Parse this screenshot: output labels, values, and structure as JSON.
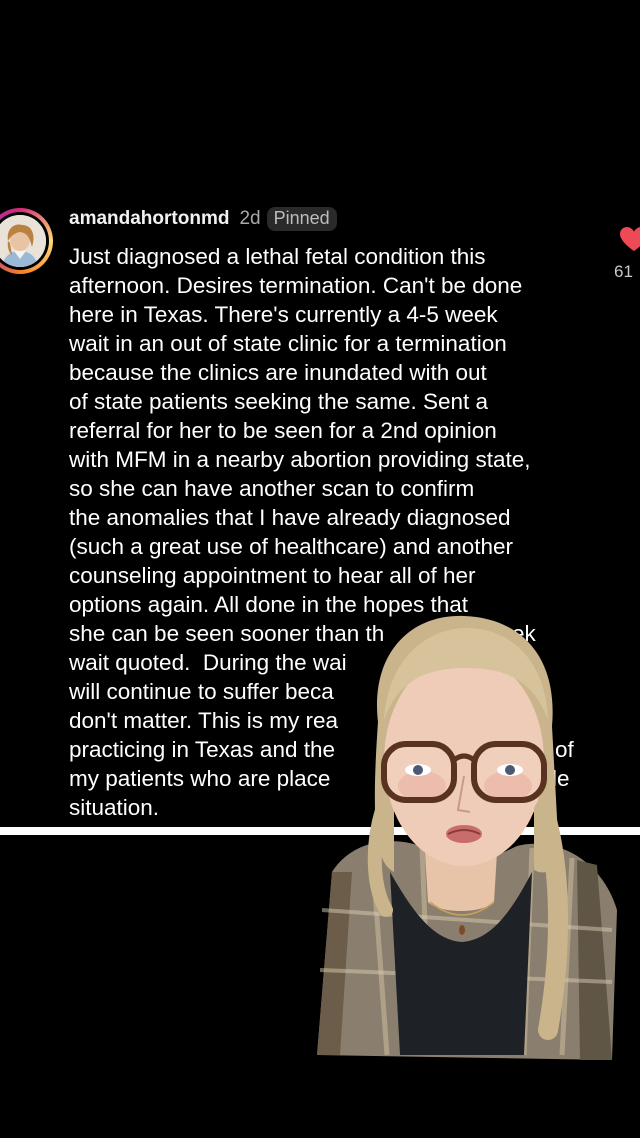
{
  "comment": {
    "username": "amandahortonmd",
    "timestamp": "2d",
    "badge": "Pinned",
    "lines": [
      "Just diagnosed a lethal fetal condition this",
      "afternoon. Desires termination. Can't be done",
      "here in Texas. There's currently a 4-5 week",
      "wait in an out of state clinic for a termination",
      "because the clinics are inundated with out",
      "of state patients seeking the same. Sent a",
      "referral for her to be seen for a 2nd opinion",
      "with MFM in a nearby abortion providing state,",
      "so she can have another scan to confirm",
      "the anomalies that I have already diagnosed",
      "(such a great use of healthcare) and another",
      "counseling appointment to hear all of her",
      "options again. All done in the hopes that",
      "she can be seen sooner than th",
      "wait quoted.  During the wai",
      "will continue to suffer beca",
      "don't matter. This is my rea",
      "practicing in Texas and the",
      "my patients who are place",
      "situation."
    ],
    "partial_right_fragments": [
      "ek",
      "of",
      "le"
    ]
  },
  "likes": {
    "count": "61",
    "icon": "heart-icon",
    "color": "#ed4956"
  },
  "colors": {
    "background": "#000000",
    "text": "#ffffff",
    "muted": "#a8a8a8",
    "divider": "#ffffff"
  }
}
